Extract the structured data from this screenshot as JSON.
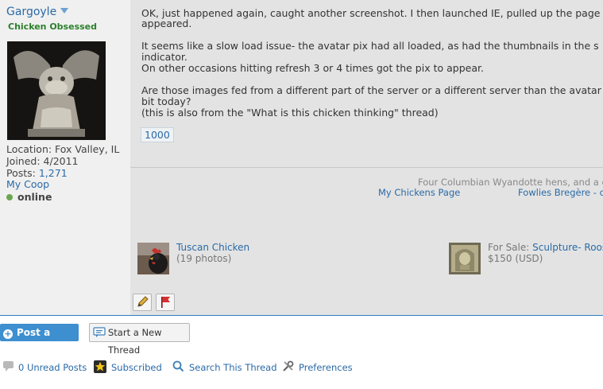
{
  "user": {
    "name": "Gargoyle",
    "title": "Chicken Obsessed",
    "location": "Location: Fox Valley, IL",
    "joined": "Joined: 4/2011",
    "posts_label": "Posts: ",
    "posts_count": "1,271",
    "coop_link": "My Coop",
    "status": "online"
  },
  "post": {
    "lines": [
      "OK, just happened again, caught another screenshot. I then launched IE, pulled up the page",
      "appeared.",
      "It seems like a slow load issue- the avatar pix had all loaded, as had the thumbnails in the s",
      "indicator.",
      "On other occasions hitting refresh 3 or 4 times got the pix to appear.",
      "Are those images fed from a different part of the server or a different server than the avatar",
      "bit today?",
      "(this is also from the \"What is this chicken thinking\" thread)"
    ],
    "tag": "1000"
  },
  "signature": {
    "text": "Four Columbian Wyandotte hens, and a c",
    "link1": "My Chickens Page",
    "link2": "Fowlies Bregère - c"
  },
  "thumbs": [
    {
      "title": "Tuscan Chicken",
      "sub": "(19 photos)"
    },
    {
      "prefix": "For Sale: ",
      "title": "Sculpture- Roos",
      "sub": "$150 (USD)"
    }
  ],
  "actions": {
    "reply": "Post a Reply",
    "new_thread": "Start a New Thread"
  },
  "tools": {
    "unread": "0 Unread Posts",
    "subscribed": "Subscribed",
    "search": "Search This Thread",
    "preferences": "Preferences"
  },
  "colors": {
    "link": "#2a6aa6",
    "accent": "#3d8fcf",
    "online": "#6aa84f"
  }
}
